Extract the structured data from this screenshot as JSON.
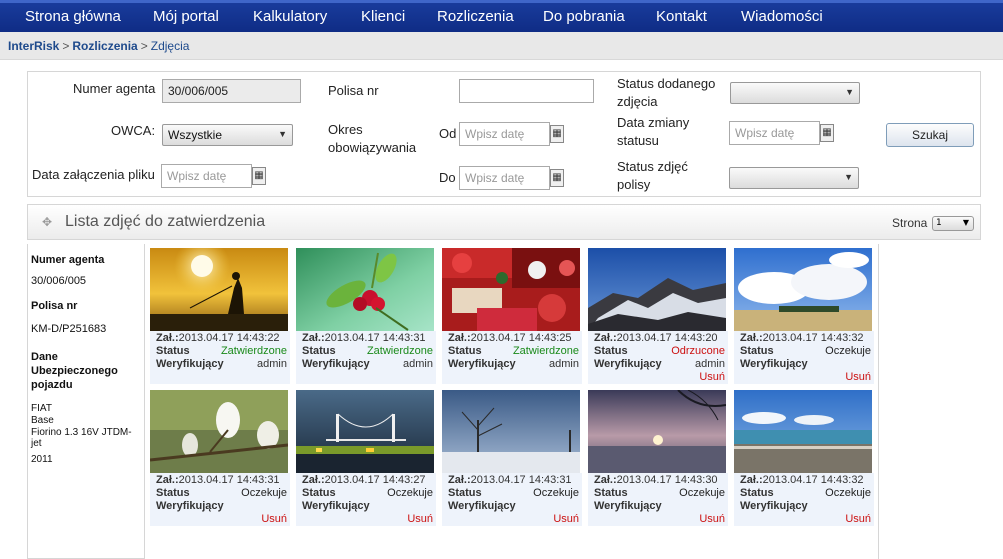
{
  "nav": {
    "items": [
      {
        "label": "Strona główna"
      },
      {
        "label": "Mój portal"
      },
      {
        "label": "Kalkulatory"
      },
      {
        "label": "Klienci"
      },
      {
        "label": "Rozliczenia"
      },
      {
        "label": "Do pobrania"
      },
      {
        "label": "Kontakt"
      },
      {
        "label": "Wiadomości"
      }
    ]
  },
  "breadcrumb": {
    "root": "InterRisk",
    "section": "Rozliczenia",
    "current": "Zdjęcia",
    "separator": ">"
  },
  "filters": {
    "agent_label": "Numer agenta",
    "agent_value": "30/006/005",
    "policy_label": "Polisa nr",
    "policy_value": "",
    "added_status_label": "Status dodanego zdjęcia",
    "added_status_value": "",
    "owca_label": "OWCA:",
    "owca_value": "Wszystkie",
    "period_label": "Okres obowiązywania",
    "from_label": "Od",
    "to_label": "Do",
    "date_placeholder": "Wpisz datę",
    "status_change_label": "Data zmiany statusu",
    "search_button": "Szukaj",
    "attach_date_label": "Data załączenia pliku",
    "policy_photos_status_label": "Status zdjęć polisy",
    "policy_photos_status_value": ""
  },
  "list": {
    "title": "Lista zdjęć do zatwierdzenia",
    "page_label": "Strona",
    "page_value": "1"
  },
  "side": {
    "agent_label": "Numer agenta",
    "agent_value": "30/006/005",
    "policy_label": "Polisa nr",
    "policy_value": "KM-D/P251683",
    "vehicle_label": "Dane Ubezpieczonego pojazdu",
    "vehicle_lines": [
      "FIAT",
      "Base",
      "Fiorino 1.3 16V JTDM-jet",
      "2011"
    ]
  },
  "labels": {
    "added": "Zał.:",
    "status": "Status",
    "verifier": "Weryfikujący",
    "delete": "Usuń"
  },
  "colors": {
    "nav_bg": "#0f2c85",
    "approved": "#1a8a1a",
    "rejected": "#cc1111",
    "pending": "#222222",
    "link": "#1e4a8c"
  },
  "photos": [
    {
      "date": "2013.04.17 14:43:22",
      "status": "Zatwierdzone",
      "status_kind": "approved",
      "verifier": "admin",
      "delete": false,
      "scene": "sunset-fisherman"
    },
    {
      "date": "2013.04.17 14:43:31",
      "status": "Zatwierdzone",
      "status_kind": "approved",
      "verifier": "admin",
      "delete": false,
      "scene": "red-berries"
    },
    {
      "date": "2013.04.17 14:43:25",
      "status": "Zatwierdzone",
      "status_kind": "approved",
      "verifier": "admin",
      "delete": false,
      "scene": "market-stall"
    },
    {
      "date": "2013.04.17 14:43:20",
      "status": "Odrzucone",
      "status_kind": "rejected",
      "verifier": "admin",
      "delete": true,
      "scene": "snowy-rocks"
    },
    {
      "date": "2013.04.17 14:43:32",
      "status": "Oczekuje",
      "status_kind": "pending",
      "verifier": "",
      "delete": true,
      "scene": "clouds-field"
    },
    {
      "date": "2013.04.17 14:43:31",
      "status": "Oczekuje",
      "status_kind": "pending",
      "verifier": "",
      "delete": true,
      "scene": "magnolia"
    },
    {
      "date": "2013.04.17 14:43:27",
      "status": "Oczekuje",
      "status_kind": "pending",
      "verifier": "",
      "delete": true,
      "scene": "night-bridge"
    },
    {
      "date": "2013.04.17 14:43:31",
      "status": "Oczekuje",
      "status_kind": "pending",
      "verifier": "",
      "delete": true,
      "scene": "winter-tree"
    },
    {
      "date": "2013.04.17 14:43:30",
      "status": "Oczekuje",
      "status_kind": "pending",
      "verifier": "",
      "delete": true,
      "scene": "lake-sunset"
    },
    {
      "date": "2013.04.17 14:43:32",
      "status": "Oczekuje",
      "status_kind": "pending",
      "verifier": "",
      "delete": true,
      "scene": "beach-sea"
    }
  ]
}
